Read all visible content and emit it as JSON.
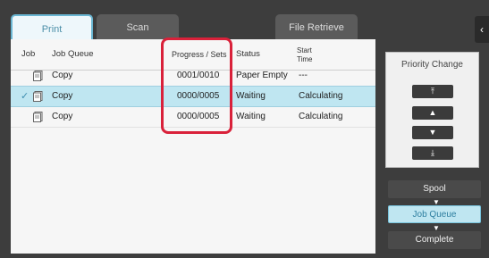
{
  "tabs": [
    {
      "label": "Print",
      "active": true
    },
    {
      "label": "Scan",
      "active": false
    },
    {
      "label": "File Retrieve",
      "active": false
    }
  ],
  "table": {
    "headers": {
      "job": "Job",
      "queue": "Job Queue",
      "progress": "Progress / Sets",
      "status": "Status",
      "start_line1": "Start",
      "start_line2": "Time"
    },
    "rows": [
      {
        "queue": "Copy",
        "progress": "0001/0010",
        "status": "Paper Empty",
        "start": "---",
        "selected": false
      },
      {
        "queue": "Copy",
        "progress": "0000/0005",
        "status": "Waiting",
        "start": "Calculating",
        "selected": true
      },
      {
        "queue": "Copy",
        "progress": "0000/0005",
        "status": "Waiting",
        "start": "Calculating",
        "selected": false
      }
    ]
  },
  "priority": {
    "title": "Priority Change",
    "buttons": [
      {
        "name": "move-top",
        "glyph": "⤒"
      },
      {
        "name": "move-up",
        "glyph": "▲"
      },
      {
        "name": "move-down",
        "glyph": "▼"
      },
      {
        "name": "move-bottom",
        "glyph": "⤓"
      }
    ]
  },
  "views": {
    "spool": "Spool",
    "job_queue": "Job Queue",
    "complete": "Complete"
  },
  "colors": {
    "highlight": "#d9213a",
    "selected_row": "#bfe6f1",
    "accent": "#6ab6d2"
  },
  "close_tab_glyph": "‹"
}
